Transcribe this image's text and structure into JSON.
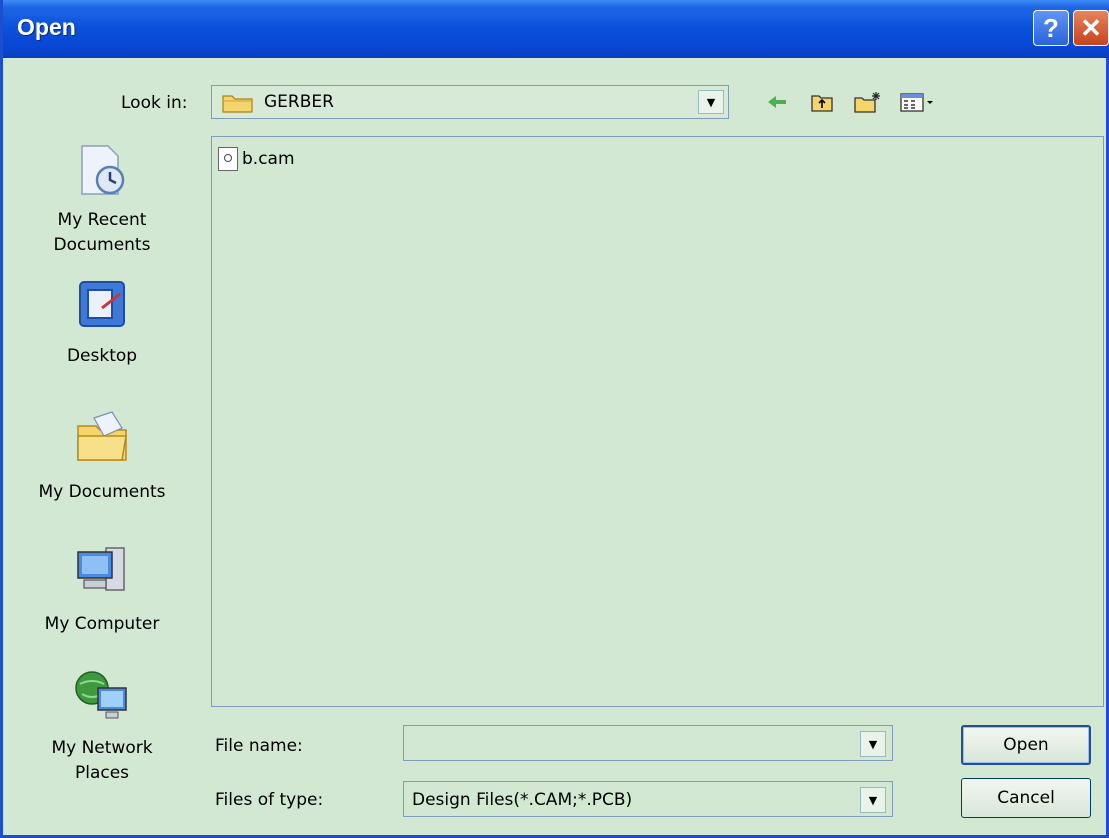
{
  "window": {
    "title": "Open"
  },
  "titlebar": {
    "help_label": "?",
    "close_label": "✕"
  },
  "lookin": {
    "label": "Look in:",
    "value": "GERBER"
  },
  "places": [
    {
      "label": "My Recent Documents"
    },
    {
      "label": "Desktop"
    },
    {
      "label": "My Documents"
    },
    {
      "label": "My Computer"
    },
    {
      "label": "My Network Places"
    }
  ],
  "files": [
    {
      "name": "b.cam"
    }
  ],
  "filename": {
    "label": "File name:",
    "value": ""
  },
  "filetype": {
    "label": "Files of type:",
    "value": "Design Files(*.CAM;*.PCB)"
  },
  "buttons": {
    "open": "Open",
    "cancel": "Cancel"
  },
  "icons": [
    "back-icon",
    "up-folder-icon",
    "new-folder-icon",
    "views-menu-icon",
    "folder-icon",
    "chevron-down-icon"
  ]
}
